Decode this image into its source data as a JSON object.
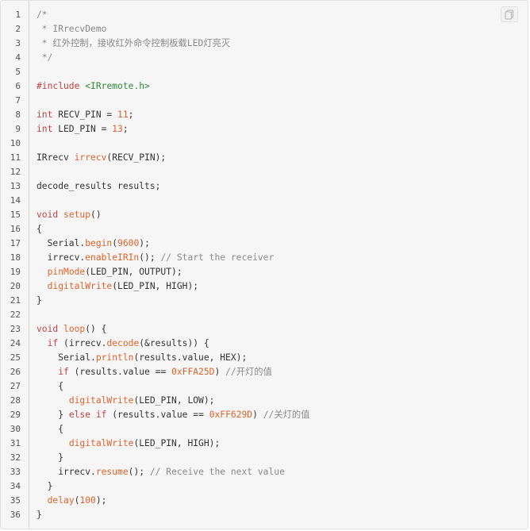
{
  "code_block": {
    "copy_icon": "copy-icon",
    "colors": {
      "background": "#f6f6f6",
      "comment": "#8a8a8a",
      "keyword": "#c0403f",
      "number": "#e0622a",
      "function": "#e0622a",
      "string": "#2e8a3a",
      "text": "#333333"
    },
    "lines": [
      [
        {
          "t": "/*",
          "c": "comment"
        }
      ],
      [
        {
          "t": " * IRrecvDemo",
          "c": "comment"
        }
      ],
      [
        {
          "t": " * 红外控制，接收红外命令控制板载LED灯亮灭",
          "c": "comment"
        }
      ],
      [
        {
          "t": " */",
          "c": "comment"
        }
      ],
      [],
      [
        {
          "t": "#include",
          "c": "keyword"
        },
        {
          "t": " ",
          "c": "plain"
        },
        {
          "t": "<IRremote.h>",
          "c": "string"
        }
      ],
      [],
      [
        {
          "t": "int",
          "c": "keyword"
        },
        {
          "t": " RECV_PIN = ",
          "c": "plain"
        },
        {
          "t": "11",
          "c": "number"
        },
        {
          "t": ";",
          "c": "plain"
        }
      ],
      [
        {
          "t": "int",
          "c": "keyword"
        },
        {
          "t": " LED_PIN = ",
          "c": "plain"
        },
        {
          "t": "13",
          "c": "number"
        },
        {
          "t": ";",
          "c": "plain"
        }
      ],
      [],
      [
        {
          "t": "IRrecv ",
          "c": "plain"
        },
        {
          "t": "irrecv",
          "c": "func"
        },
        {
          "t": "(RECV_PIN);",
          "c": "plain"
        }
      ],
      [],
      [
        {
          "t": "decode_results results;",
          "c": "plain"
        }
      ],
      [],
      [
        {
          "t": "void",
          "c": "keyword"
        },
        {
          "t": " ",
          "c": "plain"
        },
        {
          "t": "setup",
          "c": "func"
        },
        {
          "t": "()",
          "c": "plain"
        }
      ],
      [
        {
          "t": "{",
          "c": "plain"
        }
      ],
      [
        {
          "t": "  Serial.",
          "c": "plain"
        },
        {
          "t": "begin",
          "c": "func"
        },
        {
          "t": "(",
          "c": "plain"
        },
        {
          "t": "9600",
          "c": "number"
        },
        {
          "t": ");",
          "c": "plain"
        }
      ],
      [
        {
          "t": "  irrecv.",
          "c": "plain"
        },
        {
          "t": "enableIRIn",
          "c": "func"
        },
        {
          "t": "(); ",
          "c": "plain"
        },
        {
          "t": "// Start the receiver",
          "c": "comment"
        }
      ],
      [
        {
          "t": "  ",
          "c": "plain"
        },
        {
          "t": "pinMode",
          "c": "func"
        },
        {
          "t": "(LED_PIN, OUTPUT);",
          "c": "plain"
        }
      ],
      [
        {
          "t": "  ",
          "c": "plain"
        },
        {
          "t": "digitalWrite",
          "c": "func"
        },
        {
          "t": "(LED_PIN, HIGH);",
          "c": "plain"
        }
      ],
      [
        {
          "t": "}",
          "c": "plain"
        }
      ],
      [],
      [
        {
          "t": "void",
          "c": "keyword"
        },
        {
          "t": " ",
          "c": "plain"
        },
        {
          "t": "loop",
          "c": "func"
        },
        {
          "t": "() {",
          "c": "plain"
        }
      ],
      [
        {
          "t": "  ",
          "c": "plain"
        },
        {
          "t": "if",
          "c": "keyword"
        },
        {
          "t": " (irrecv.",
          "c": "plain"
        },
        {
          "t": "decode",
          "c": "func"
        },
        {
          "t": "(&results)) {",
          "c": "plain"
        }
      ],
      [
        {
          "t": "    Serial.",
          "c": "plain"
        },
        {
          "t": "println",
          "c": "func"
        },
        {
          "t": "(results.value, HEX);",
          "c": "plain"
        }
      ],
      [
        {
          "t": "    ",
          "c": "plain"
        },
        {
          "t": "if",
          "c": "keyword"
        },
        {
          "t": " (results.value == ",
          "c": "plain"
        },
        {
          "t": "0xFFA25D",
          "c": "number"
        },
        {
          "t": ") ",
          "c": "plain"
        },
        {
          "t": "//开灯的值",
          "c": "comment"
        }
      ],
      [
        {
          "t": "    {",
          "c": "plain"
        }
      ],
      [
        {
          "t": "      ",
          "c": "plain"
        },
        {
          "t": "digitalWrite",
          "c": "func"
        },
        {
          "t": "(LED_PIN, LOW);",
          "c": "plain"
        }
      ],
      [
        {
          "t": "    } ",
          "c": "plain"
        },
        {
          "t": "else",
          "c": "keyword"
        },
        {
          "t": " ",
          "c": "plain"
        },
        {
          "t": "if",
          "c": "keyword"
        },
        {
          "t": " (results.value == ",
          "c": "plain"
        },
        {
          "t": "0xFF629D",
          "c": "number"
        },
        {
          "t": ") ",
          "c": "plain"
        },
        {
          "t": "//关灯的值",
          "c": "comment"
        }
      ],
      [
        {
          "t": "    {",
          "c": "plain"
        }
      ],
      [
        {
          "t": "      ",
          "c": "plain"
        },
        {
          "t": "digitalWrite",
          "c": "func"
        },
        {
          "t": "(LED_PIN, HIGH);",
          "c": "plain"
        }
      ],
      [
        {
          "t": "    }",
          "c": "plain"
        }
      ],
      [
        {
          "t": "    irrecv.",
          "c": "plain"
        },
        {
          "t": "resume",
          "c": "func"
        },
        {
          "t": "(); ",
          "c": "plain"
        },
        {
          "t": "// Receive the next value",
          "c": "comment"
        }
      ],
      [
        {
          "t": "  }",
          "c": "plain"
        }
      ],
      [
        {
          "t": "  ",
          "c": "plain"
        },
        {
          "t": "delay",
          "c": "func"
        },
        {
          "t": "(",
          "c": "plain"
        },
        {
          "t": "100",
          "c": "number"
        },
        {
          "t": ");",
          "c": "plain"
        }
      ],
      [
        {
          "t": "}",
          "c": "plain"
        }
      ]
    ]
  }
}
